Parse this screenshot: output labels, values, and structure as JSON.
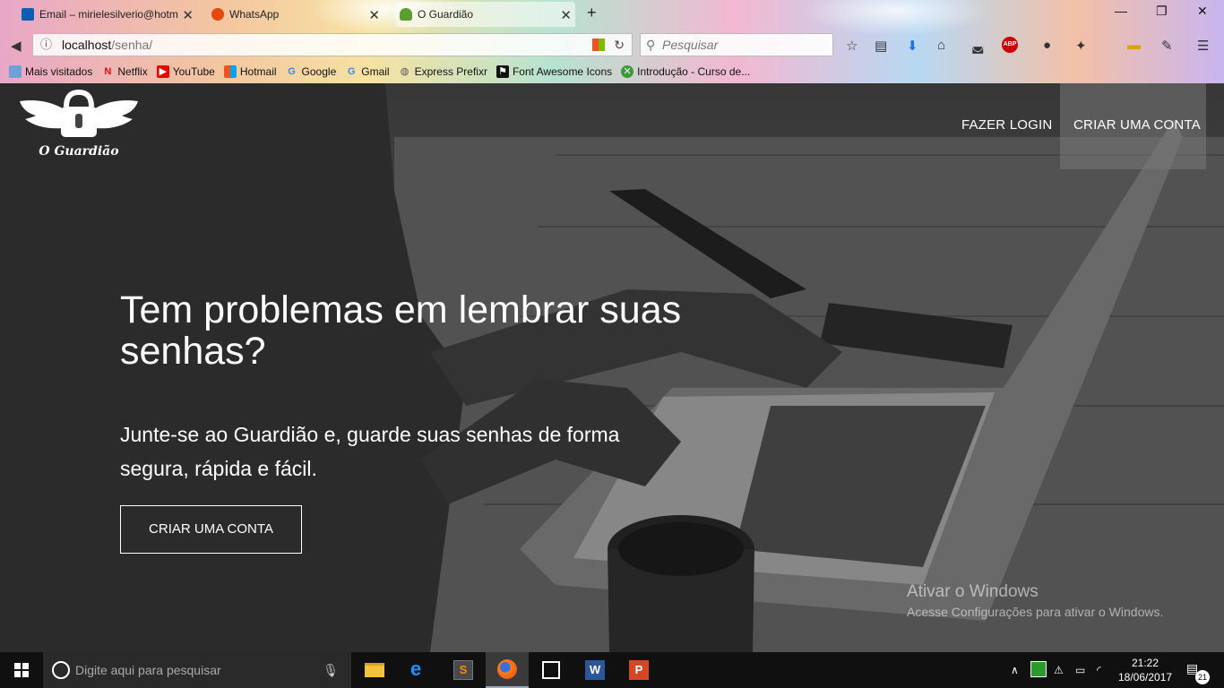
{
  "browser": {
    "tabs": [
      {
        "label": "Email – mirielesilverio@hotm",
        "active": false
      },
      {
        "label": "WhatsApp",
        "active": false
      },
      {
        "label": "O Guardião",
        "active": true
      }
    ],
    "url_host": "localhost",
    "url_path": "/senha/",
    "search_placeholder": "Pesquisar",
    "bookmarks": [
      "Mais visitados",
      "Netflix",
      "YouTube",
      "Hotmail",
      "Google",
      "Gmail",
      "Express Prefixr",
      "Font Awesome Icons",
      "Introdução - Curso de..."
    ]
  },
  "site": {
    "brand_name": "O Guardião",
    "nav": {
      "login": "FAZER LOGIN",
      "signup": "CRIAR UMA CONTA"
    },
    "hero": {
      "title": "Tem problemas em lembrar suas senhas?",
      "subtitle": "Junte-se ao Guardião e, guarde suas senhas de forma segura, rápida e fácil.",
      "cta": "CRIAR UMA CONTA"
    },
    "watermark": {
      "title": "Ativar o Windows",
      "text": "Acesse Configurações para ativar o Windows."
    }
  },
  "taskbar": {
    "search_placeholder": "Digite aqui para pesquisar",
    "time": "21:22",
    "date": "18/06/2017",
    "notifications": "21"
  },
  "colors": {
    "accent": "#ffffff",
    "page_overlay": "#000000",
    "taskbar": "#101010"
  }
}
